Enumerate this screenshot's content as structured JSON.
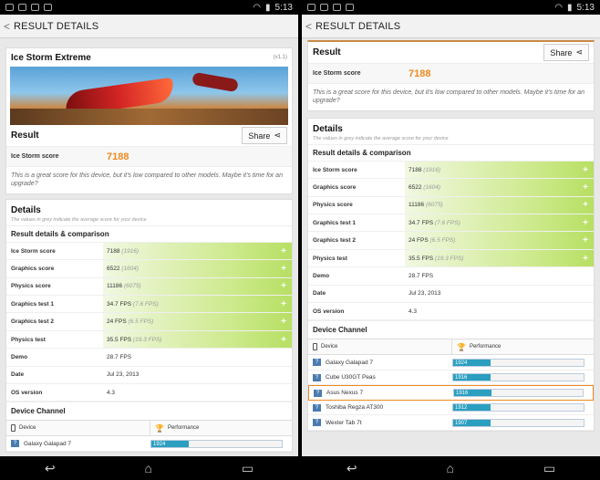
{
  "status": {
    "time": "5:13"
  },
  "app": {
    "title": "RESULT DETAILS",
    "back_glyph": "<"
  },
  "nav": {
    "back": "↩",
    "home": "⌂",
    "recent": "▭"
  },
  "test": {
    "name": "Ice Storm Extreme",
    "version": "(v1.1)"
  },
  "result": {
    "title": "Result",
    "share_label": "Share",
    "score_label": "Ice Storm score",
    "score": "7188",
    "comment": "This is a great score for this device, but it's low compared to other models. Maybe it's time for an upgrade?"
  },
  "details": {
    "title": "Details",
    "subtitle": "The values in grey indicate the average score for your device",
    "section": "Result details & comparison",
    "rows": [
      {
        "label": "Ice Storm score",
        "value": "7188",
        "avg": "(1916)"
      },
      {
        "label": "Graphics score",
        "value": "6522",
        "avg": "(1604)"
      },
      {
        "label": "Physics score",
        "value": "11186",
        "avg": "(6075)"
      },
      {
        "label": "Graphics test 1",
        "value": "34.7 FPS",
        "avg": "(7.6 FPS)"
      },
      {
        "label": "Graphics test 2",
        "value": "24 FPS",
        "avg": "(6.5 FPS)"
      },
      {
        "label": "Physics test",
        "value": "35.5 FPS",
        "avg": "(19.3 FPS)"
      }
    ],
    "info": [
      {
        "label": "Demo",
        "value": "28.7 FPS"
      },
      {
        "label": "Date",
        "value": "Jul 23, 2013"
      },
      {
        "label": "OS version",
        "value": "4.3"
      }
    ],
    "plus_glyph": "+"
  },
  "channel": {
    "title": "Device Channel",
    "col_device": "Device",
    "col_perf": "Performance",
    "badge_glyph": "?",
    "devices": [
      {
        "name": "Galaxy Galapad 7",
        "score": "1924",
        "fill": 0.29
      },
      {
        "name": "Cube U30GT Peas",
        "score": "1916",
        "fill": 0.29
      },
      {
        "name": "Asus Nexus 7",
        "score": "1916",
        "fill": 0.29
      },
      {
        "name": "Toshiba Regza AT300",
        "score": "1912",
        "fill": 0.29
      },
      {
        "name": "Wexler Tab 7t",
        "score": "1907",
        "fill": 0.29
      }
    ]
  },
  "colors": {
    "accent": "#ef8a1f",
    "bar": "#2a9fc0",
    "green": "#b7df63"
  }
}
